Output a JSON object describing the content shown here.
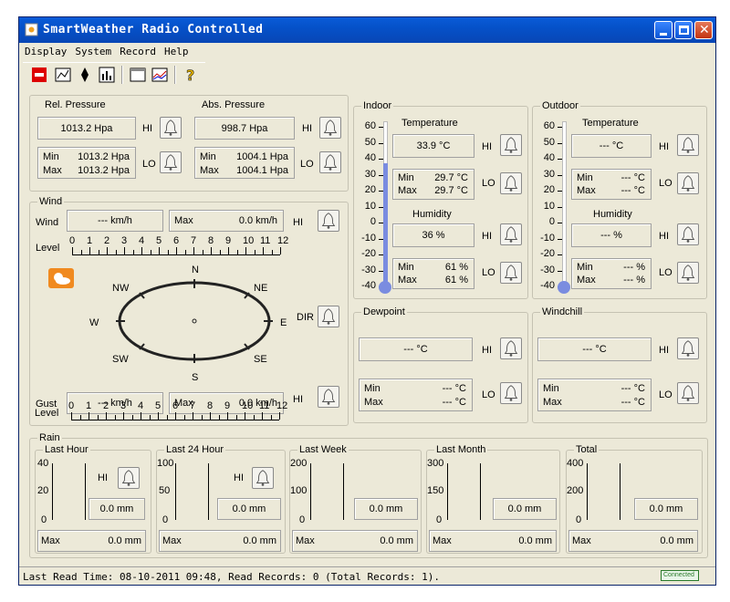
{
  "window": {
    "title": "SmartWeather Radio Controlled"
  },
  "menu": [
    "Display",
    "System",
    "Record",
    "Help"
  ],
  "status": "Last Read Time: 08-10-2011 09:48, Read Records: 0 (Total Records: 1).",
  "status_badge": "Connected",
  "hi": "HI",
  "lo": "LO",
  "min": "Min",
  "max": "Max",
  "pressure": {
    "rel": {
      "label": "Rel. Pressure",
      "value": "1013.2 Hpa",
      "min": "1013.2 Hpa",
      "max": "1013.2 Hpa"
    },
    "abs": {
      "label": "Abs. Pressure",
      "value": "998.7 Hpa",
      "min": "1004.1 Hpa",
      "max": "1004.1 Hpa"
    }
  },
  "wind": {
    "label": "Wind",
    "wind_label": "Wind",
    "wind_value": "--- km/h",
    "max_label": "Max",
    "max_value": "0.0 km/h",
    "level_label": "Level",
    "levels": [
      "0",
      "1",
      "2",
      "3",
      "4",
      "5",
      "6",
      "7",
      "8",
      "9",
      "10",
      "11",
      "12"
    ],
    "compass": [
      "N",
      "NE",
      "E",
      "SE",
      "S",
      "SW",
      "W",
      "NW"
    ],
    "dir": "DIR",
    "gust_label": "Gust",
    "gust_value": "--- km/h",
    "gust_max_value": "0.0 km/h"
  },
  "indoor": {
    "label": "Indoor",
    "scale": [
      "60",
      "50",
      "40",
      "30",
      "20",
      "10",
      "0",
      "-10",
      "-20",
      "-30",
      "-40"
    ],
    "temperature_label": "Temperature",
    "temperature": "33.9 °C",
    "temp_min": "29.7 °C",
    "temp_max": "29.7 °C",
    "humidity_label": "Humidity",
    "humidity": "36 %",
    "hum_min": "61 %",
    "hum_max": "61 %"
  },
  "outdoor": {
    "label": "Outdoor",
    "scale": [
      "60",
      "50",
      "40",
      "30",
      "20",
      "10",
      "0",
      "-10",
      "-20",
      "-30",
      "-40"
    ],
    "temperature_label": "Temperature",
    "temperature": "--- °C",
    "temp_min": "--- °C",
    "temp_max": "--- °C",
    "humidity_label": "Humidity",
    "humidity": "--- %",
    "hum_min": "--- %",
    "hum_max": "--- %"
  },
  "dewpoint": {
    "label": "Dewpoint",
    "value": "--- °C",
    "min": "--- °C",
    "max": "--- °C"
  },
  "windchill": {
    "label": "Windchill",
    "value": "--- °C",
    "min": "--- °C",
    "max": "--- °C"
  },
  "rain": {
    "label": "Rain",
    "last_hour": {
      "label": "Last Hour",
      "ticks": [
        "40",
        "20",
        "0"
      ],
      "value": "0.0 mm",
      "max": "0.0 mm"
    },
    "last_24": {
      "label": "Last 24 Hour",
      "ticks": [
        "100",
        "50",
        "0"
      ],
      "value": "0.0 mm",
      "max": "0.0 mm"
    },
    "last_week": {
      "label": "Last Week",
      "ticks": [
        "200",
        "100",
        "0"
      ],
      "value": "0.0 mm",
      "max": "0.0 mm"
    },
    "last_month": {
      "label": "Last Month",
      "ticks": [
        "300",
        "150",
        "0"
      ],
      "value": "0.0 mm",
      "max": "0.0 mm"
    },
    "total": {
      "label": "Total",
      "ticks": [
        "400",
        "200",
        "0"
      ],
      "value": "0.0 mm",
      "max": "0.0 mm"
    }
  }
}
